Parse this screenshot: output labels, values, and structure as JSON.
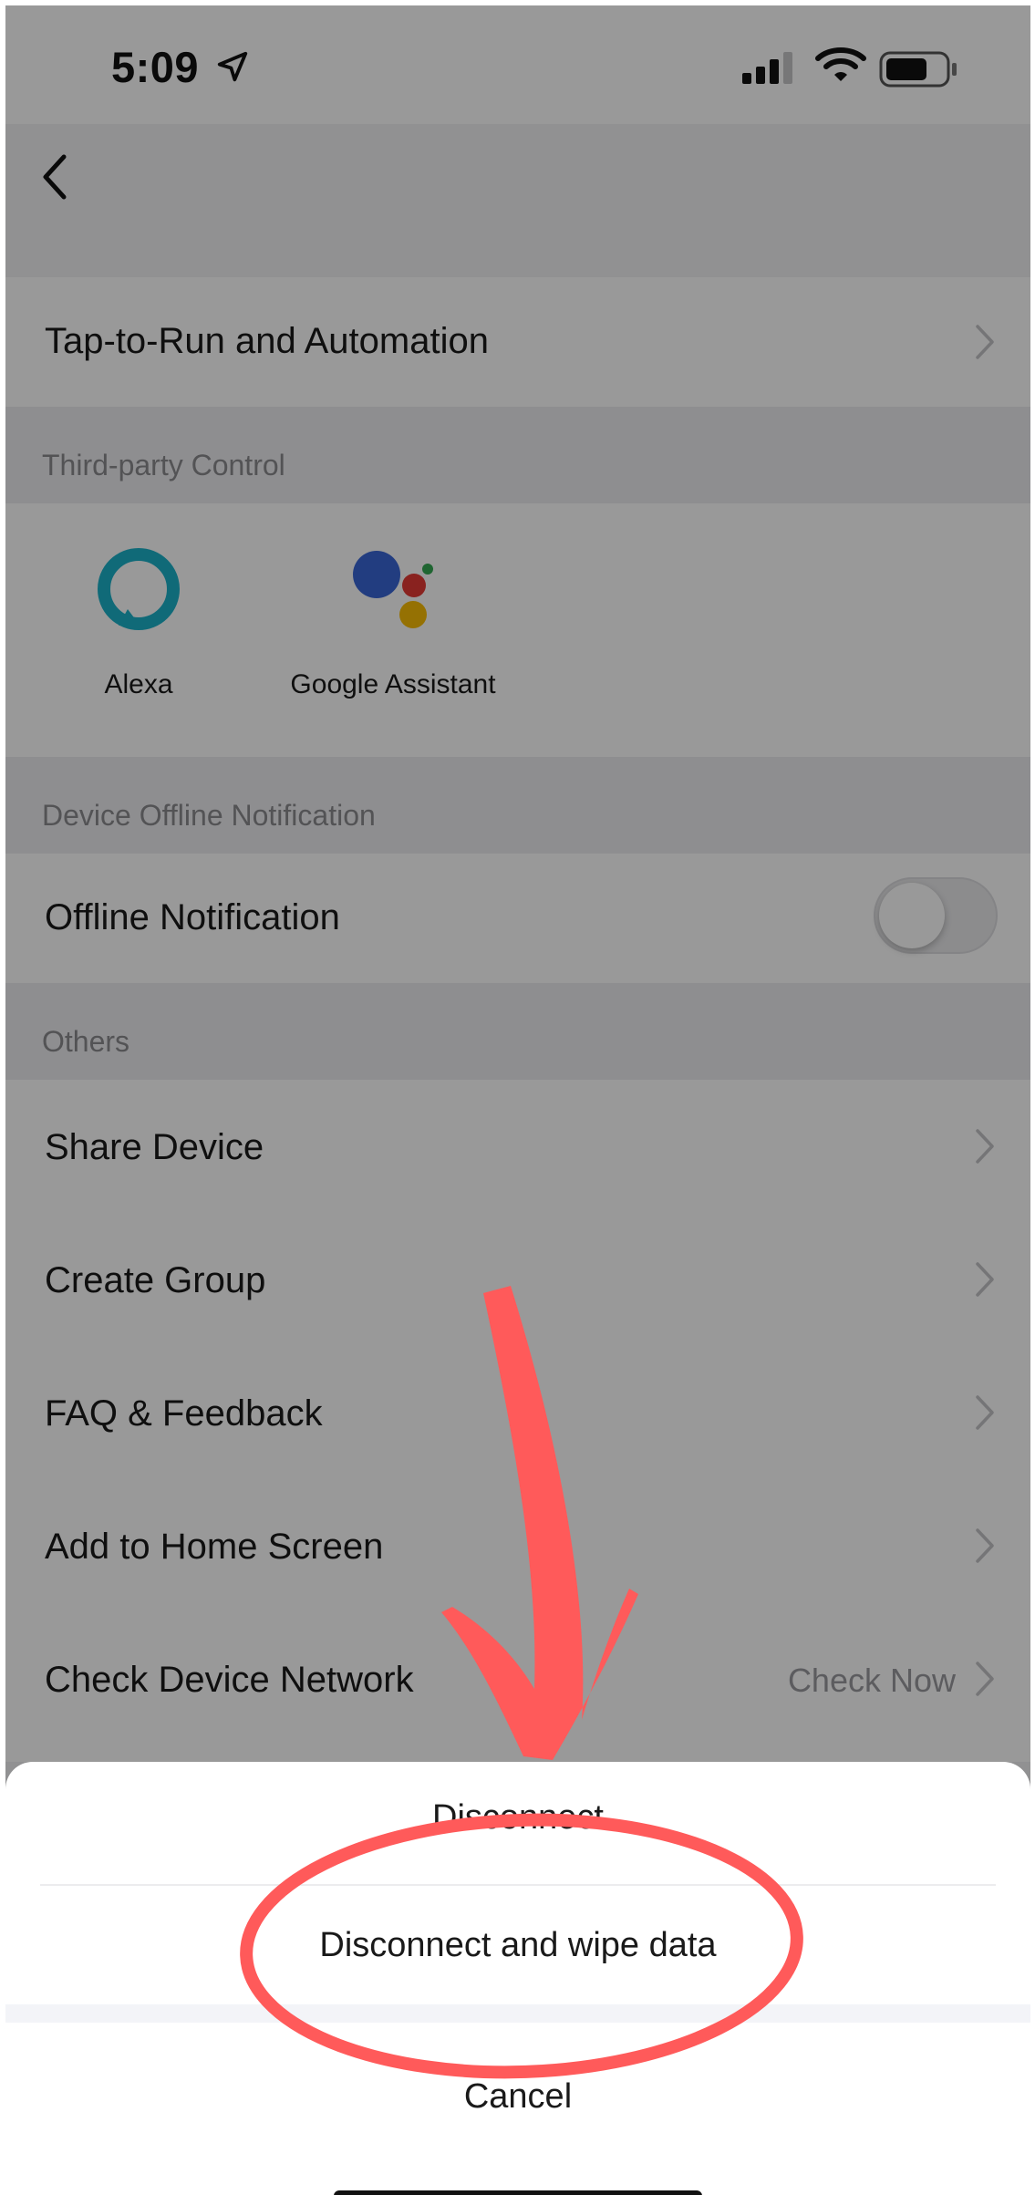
{
  "status_bar": {
    "time": "5:09"
  },
  "rows": {
    "tap_to_run": "Tap-to-Run and Automation",
    "offline_notification": "Offline Notification",
    "share_device": "Share Device",
    "create_group": "Create Group",
    "faq": "FAQ & Feedback",
    "add_home": "Add to Home Screen",
    "check_network": "Check Device Network",
    "check_now": "Check Now"
  },
  "sections": {
    "third_party": "Third-party Control",
    "offline": "Device Offline Notification",
    "others": "Others"
  },
  "third_party": {
    "alexa": "Alexa",
    "google": "Google Assistant"
  },
  "toggles": {
    "offline_notification": false
  },
  "sheet": {
    "disconnect": "Disconnect",
    "disconnect_wipe": "Disconnect and wipe data",
    "cancel": "Cancel"
  },
  "icons": [
    "location-arrow-icon",
    "signal-icon",
    "wifi-icon",
    "battery-icon",
    "back-chevron-icon",
    "chevron-right-icon",
    "alexa-icon",
    "google-assistant-icon"
  ],
  "colors": {
    "annotation": "#ff5a5a",
    "alexa": "#1bb1c9",
    "overlay": "rgba(0,0,0,0.40)"
  }
}
